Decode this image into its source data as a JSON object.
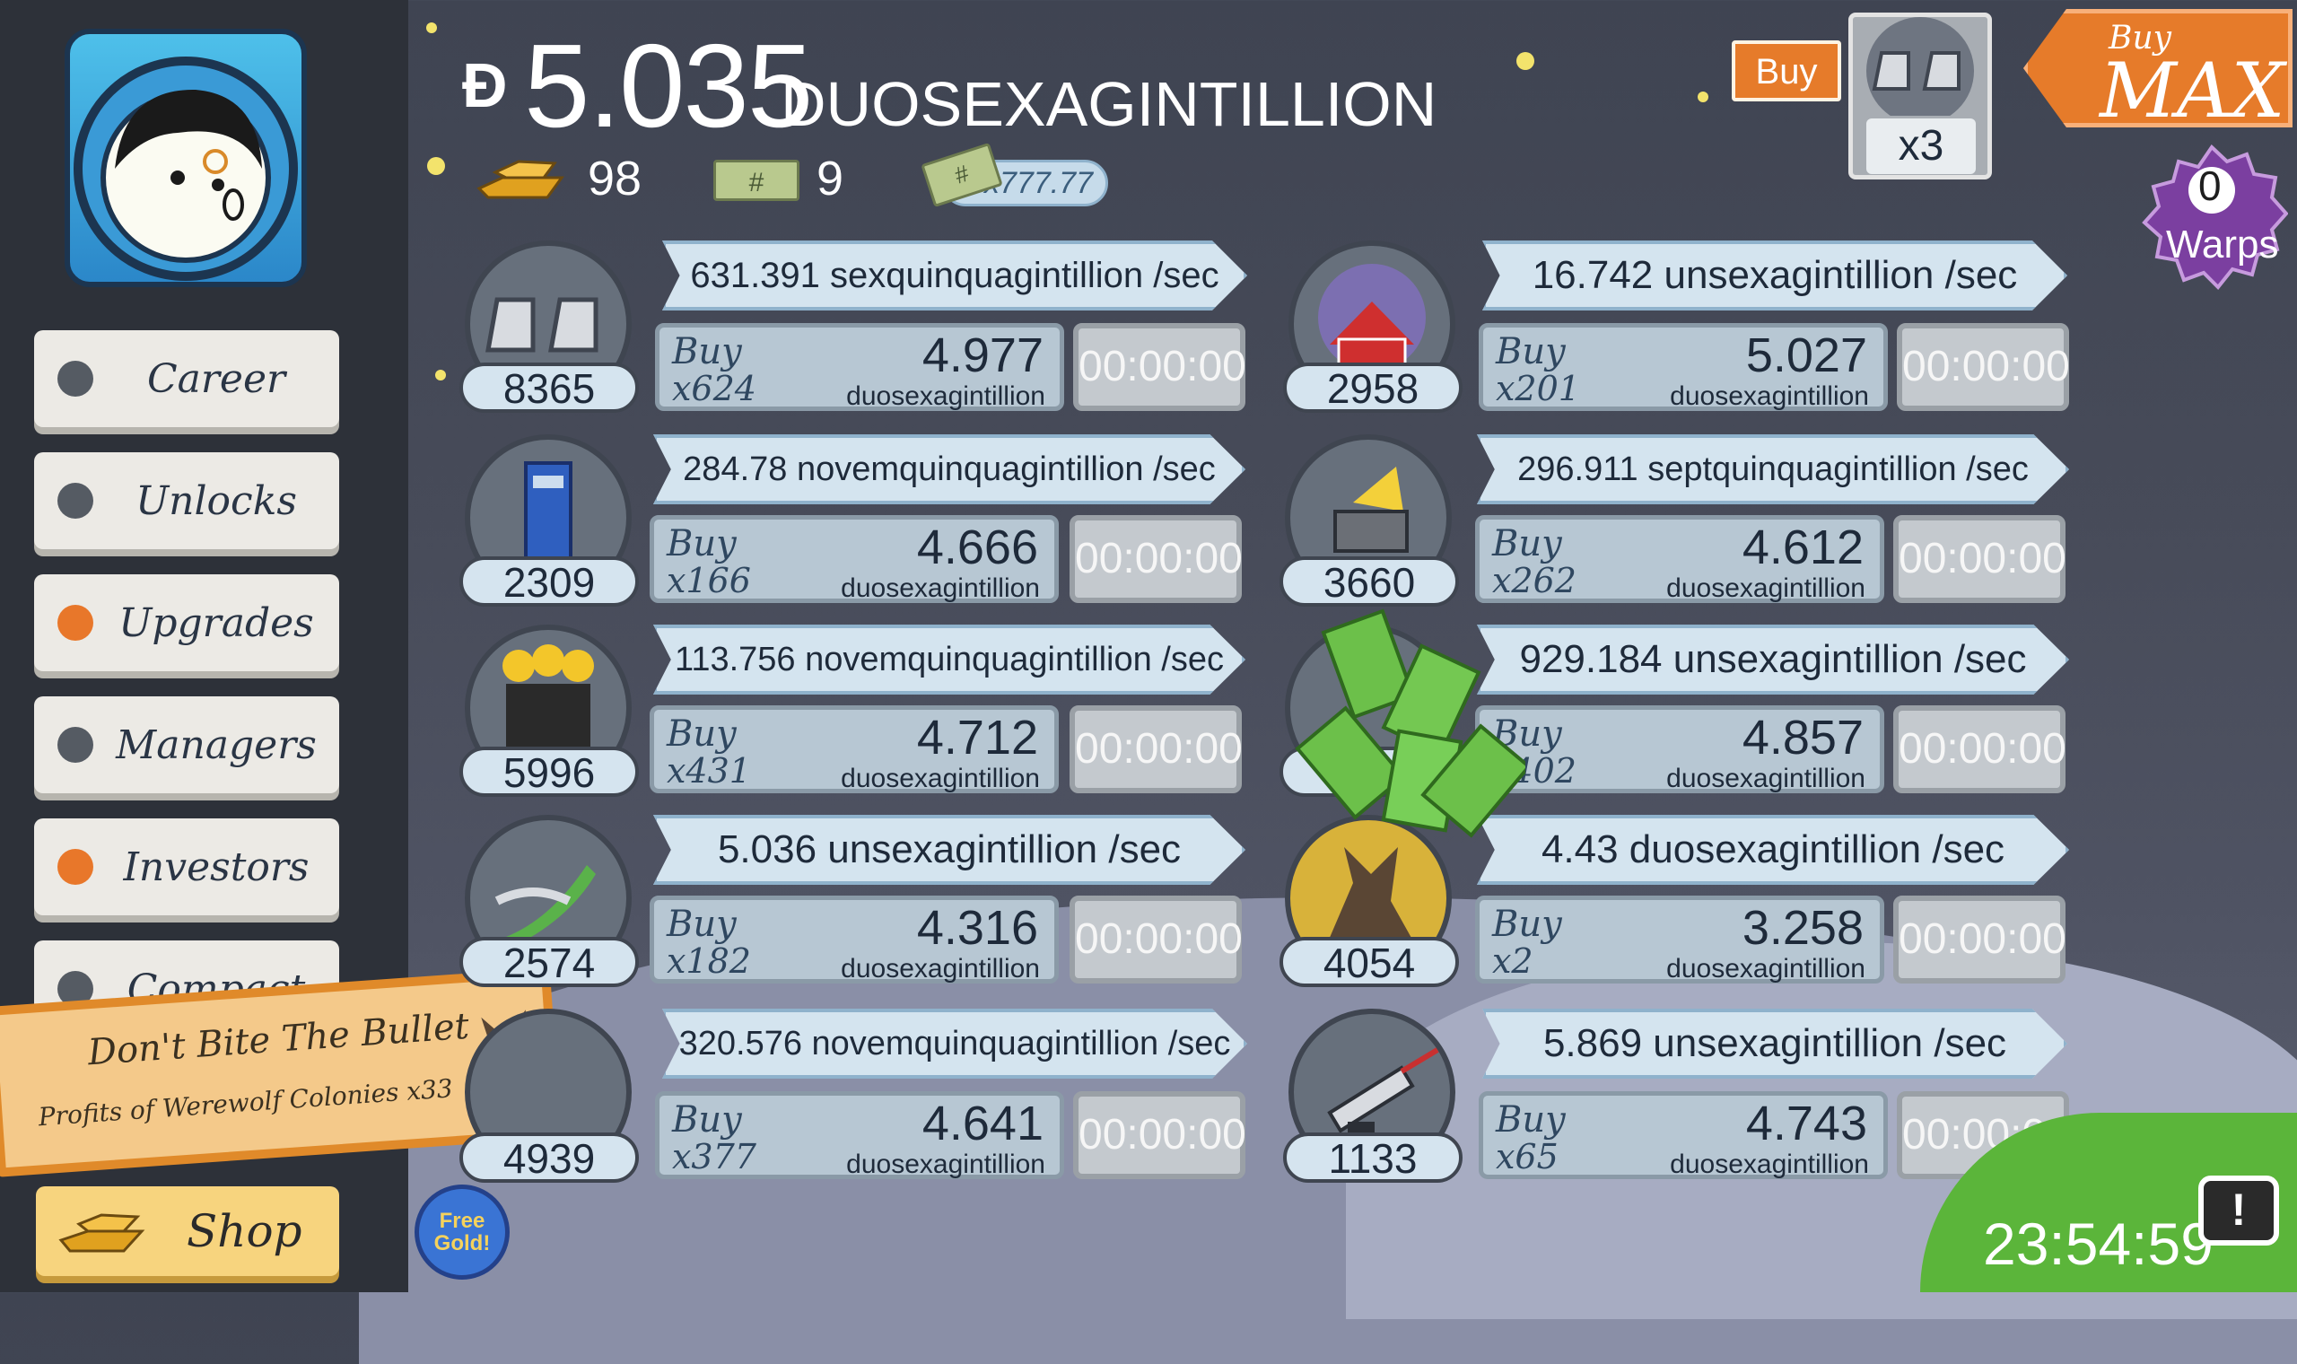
{
  "header": {
    "currency_symbol": "Ð",
    "money_value": "5.035",
    "money_unit": "DUOSEXAGINTILLION",
    "gold_bars": "98",
    "mega_bucks": "9",
    "angel_multiplier": "x777.77",
    "buy_label": "Buy",
    "boost_count": "x3",
    "buy_max_small": "Buy",
    "buy_max_big": "MAX",
    "warps_count": "0",
    "warps_label": "Warps"
  },
  "sidebar": {
    "items": [
      {
        "label": "Career",
        "alert": false
      },
      {
        "label": "Unlocks",
        "alert": false
      },
      {
        "label": "Upgrades",
        "alert": true
      },
      {
        "label": "Managers",
        "alert": false
      },
      {
        "label": "Investors",
        "alert": true
      },
      {
        "label": "Compact",
        "alert": false
      }
    ],
    "shop_label": "Shop",
    "free_gold_label": "Free Gold!"
  },
  "banner": {
    "title": "Don't Bite The Bullet",
    "subtitle": "Profits of Werewolf Colonies x33"
  },
  "businesses": [
    {
      "icon": "moon-boots-icon",
      "count": "8365",
      "rate": "631.391 sexquinquagintillion /sec",
      "qty": "x624",
      "cost": "4.977",
      "unit": "duosexagintillion",
      "timer": "00:00:00"
    },
    {
      "icon": "moon-barn-icon",
      "count": "2958",
      "rate": "16.742 unsexagintillion /sec",
      "qty": "x201",
      "cost": "5.027",
      "unit": "duosexagintillion",
      "timer": "00:00:00"
    },
    {
      "icon": "police-box-icon",
      "count": "2309",
      "rate": "284.78 novemquinquagintillion /sec",
      "qty": "x166",
      "cost": "4.666",
      "unit": "duosexagintillion",
      "timer": "00:00:00"
    },
    {
      "icon": "cheese-mine-icon",
      "count": "3660",
      "rate": "296.911 septquinquagintillion /sec",
      "qty": "x262",
      "cost": "4.612",
      "unit": "duosexagintillion",
      "timer": "00:00:00"
    },
    {
      "icon": "podium-icon",
      "count": "5996",
      "rate": "113.756 novemquinquagintillion /sec",
      "qty": "x431",
      "cost": "4.712",
      "unit": "duosexagintillion",
      "timer": "00:00:00"
    },
    {
      "icon": "moon-express-icon",
      "count": "",
      "rate": "929.184 unsexagintillion /sec",
      "qty": "x402",
      "cost": "4.857",
      "unit": "duosexagintillion",
      "timer": "00:00:00"
    },
    {
      "icon": "rocket-icon",
      "count": "2574",
      "rate": "5.036 unsexagintillion /sec",
      "qty": "x182",
      "cost": "4.316",
      "unit": "duosexagintillion",
      "timer": "00:00:00"
    },
    {
      "icon": "werewolf-icon",
      "count": "4054",
      "rate": "4.43 duosexagintillion /sec",
      "qty": "x2",
      "cost": "3.258",
      "unit": "duosexagintillion",
      "timer": "00:00:00"
    },
    {
      "icon": "werewolf-colony-icon",
      "count": "4939",
      "rate": "320.576 novemquinquagintillion /sec",
      "qty": "x377",
      "cost": "4.641",
      "unit": "duosexagintillion",
      "timer": "00:00:00"
    },
    {
      "icon": "death-ray-icon",
      "count": "1133",
      "rate": "5.869 unsexagintillion /sec",
      "qty": "x65",
      "cost": "4.743",
      "unit": "duosexagintillion",
      "timer": "00:00:00"
    }
  ],
  "buy_word": "Buy",
  "clock": "23:54:59",
  "tv_icon_glyph": "!",
  "colors": {
    "accent_orange": "#e67b2a",
    "panel_blue": "#d4e4ef",
    "tv_green": "#5bb53a"
  }
}
